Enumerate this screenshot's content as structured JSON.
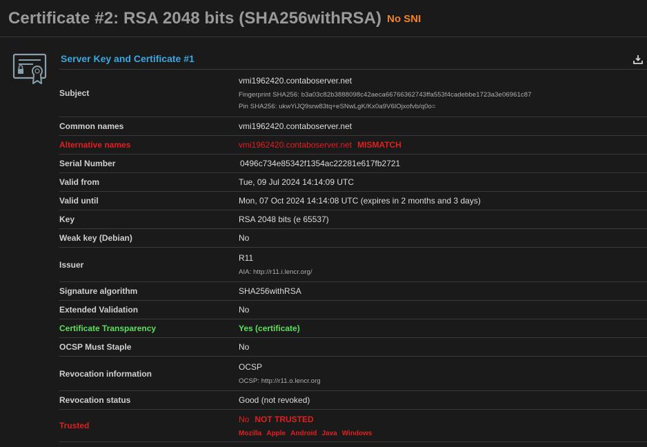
{
  "header": {
    "title": "Certificate #2: RSA 2048 bits (SHA256withRSA)",
    "badge": "No SNI"
  },
  "section": {
    "title": "Server Key and Certificate #1",
    "icon": "certificate-icon",
    "download_icon": "download-icon"
  },
  "colors": {
    "accent": "#3da7e0",
    "warning": "#f0842a",
    "error": "#e02020",
    "success": "#5ce05c"
  },
  "rows": {
    "subject": {
      "label": "Subject",
      "value": "vmi1962420.contaboserver.net",
      "fingerprint": "Fingerprint SHA256: b3a03c82b3888098c42aeca66766362743ffa553f4cadebbe1723a3e06961c87",
      "pin": "Pin SHA256: ukwYiJQ9srw83tq+eSNwLgK/Kx0a9V6lOjxofvb/q0o="
    },
    "common_names": {
      "label": "Common names",
      "value": "vmi1962420.contaboserver.net"
    },
    "alt_names": {
      "label": "Alternative names",
      "value": "vmi1962420.contaboserver.net",
      "tag": "MISMATCH"
    },
    "serial": {
      "label": "Serial Number",
      "value": "0496c734e85342f1354ac22281e617fb2721"
    },
    "valid_from": {
      "label": "Valid from",
      "value": "Tue, 09 Jul 2024 14:14:09 UTC"
    },
    "valid_until": {
      "label": "Valid until",
      "value": "Mon, 07 Oct 2024 14:14:08 UTC (expires in 2 months and 3 days)"
    },
    "key": {
      "label": "Key",
      "value": "RSA 2048 bits (e 65537)"
    },
    "weak_key": {
      "label": "Weak key (Debian)",
      "value": "No"
    },
    "issuer": {
      "label": "Issuer",
      "value": "R11",
      "aia": "AIA: http://r11.i.lencr.org/"
    },
    "sig_alg": {
      "label": "Signature algorithm",
      "value": "SHA256withRSA"
    },
    "ev": {
      "label": "Extended Validation",
      "value": "No"
    },
    "ct": {
      "label": "Certificate Transparency",
      "value": "Yes (certificate)"
    },
    "ocsp_staple": {
      "label": "OCSP Must Staple",
      "value": "No"
    },
    "revocation_info": {
      "label": "Revocation information",
      "value": "OCSP",
      "ocsp": "OCSP: http://r11.o.lencr.org"
    },
    "revocation_status": {
      "label": "Revocation status",
      "value": "Good (not revoked)"
    },
    "trusted": {
      "label": "Trusted",
      "value": "No",
      "tag": "NOT TRUSTED",
      "stores": [
        "Mozilla",
        "Apple",
        "Android",
        "Java",
        "Windows"
      ]
    }
  }
}
